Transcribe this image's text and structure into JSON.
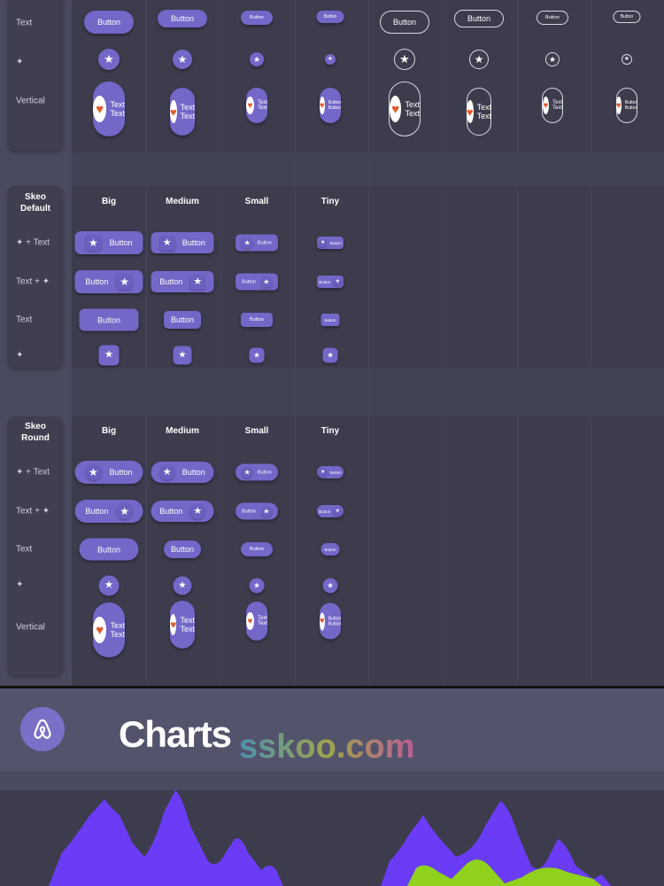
{
  "top_section": {
    "row_labels": [
      "Text",
      "✦",
      "Vertical"
    ],
    "button_label": "Button",
    "vertical_labels": [
      "Text\nText",
      "Text\nText",
      "Text\nText",
      "Button\nButton"
    ]
  },
  "skeo_default": {
    "title": "Skeo\nDefault",
    "col_headers": [
      "Big",
      "Medium",
      "Small",
      "Tiny"
    ],
    "row_labels": [
      "✦ + Text",
      "Text + ✦",
      "Text",
      "✦"
    ],
    "button_label": "Button"
  },
  "skeo_round": {
    "title": "Skeo\nRound",
    "col_headers": [
      "Big",
      "Medium",
      "Small",
      "Tiny"
    ],
    "row_labels": [
      "✦ + Text",
      "Text + ✦",
      "Text",
      "✦",
      "Vertical"
    ],
    "button_label": "Button",
    "vertical_labels": [
      "Text\nText",
      "Text\nText",
      "Text\nText",
      "Button\nButton"
    ]
  },
  "charts": {
    "title": "Charts",
    "logo_icon": "airbnb-style-logo-icon",
    "watermark": "sskoo.com"
  },
  "colors": {
    "accent": "#7367c8",
    "chart_purple": "#6a3cf5",
    "chart_green": "#8fd11c",
    "background": "#3a3a4a"
  },
  "icons": {
    "star": "star-icon",
    "emoji": "heart-eyes-emoji-icon"
  }
}
